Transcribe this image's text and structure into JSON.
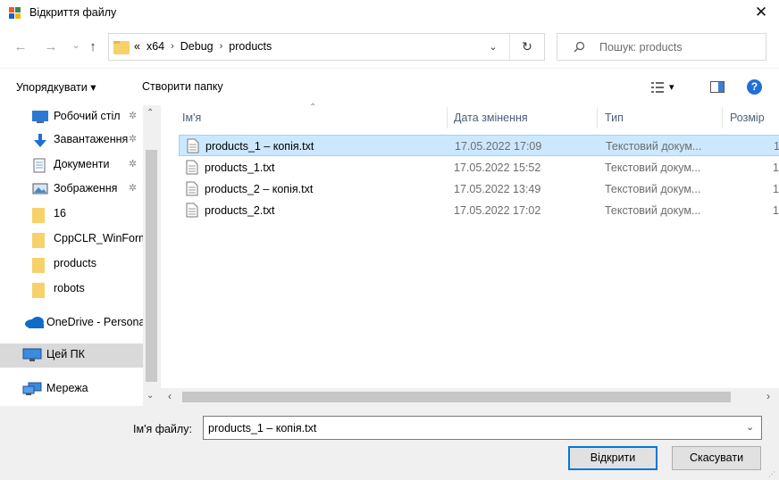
{
  "window": {
    "title": "Відкриття файлу",
    "close_glyph": "✕"
  },
  "navigation": {
    "back": "←",
    "forward": "→",
    "recent": "⌄",
    "up": "↑",
    "breadcrumb": {
      "overflow": "«",
      "items": [
        "x64",
        "Debug",
        "products"
      ],
      "separator": "›"
    },
    "refresh": "↻",
    "search_placeholder": "Пошук: products"
  },
  "toolbar": {
    "organize": "Упорядкувати ▾",
    "new_folder": "Створити папку",
    "view_caret": "▾"
  },
  "sidebar": {
    "items": [
      {
        "label": "Робочий стіл",
        "icon": "desktop-icon",
        "pinned": true
      },
      {
        "label": "Завантаження",
        "icon": "download-icon",
        "pinned": true
      },
      {
        "label": "Документи",
        "icon": "documents-icon",
        "pinned": true
      },
      {
        "label": "Зображення",
        "icon": "pictures-icon",
        "pinned": true
      },
      {
        "label": "16",
        "icon": "folder-icon",
        "pinned": false
      },
      {
        "label": "CppCLR_WinForms",
        "icon": "folder-icon",
        "pinned": false
      },
      {
        "label": "products",
        "icon": "folder-icon",
        "pinned": false
      },
      {
        "label": "robots",
        "icon": "folder-icon",
        "pinned": false
      },
      {
        "label": "OneDrive - Personal",
        "icon": "onedrive-icon",
        "pinned": false
      },
      {
        "label": "Цей ПК",
        "icon": "this-pc-icon",
        "pinned": false,
        "selected": true
      },
      {
        "label": "Мережа",
        "icon": "network-icon",
        "pinned": false
      }
    ],
    "pin_glyph": "✲"
  },
  "file_list": {
    "columns": {
      "name": "Ім'я",
      "date": "Дата змінення",
      "type": "Тип",
      "size": "Розмір"
    },
    "rows": [
      {
        "name": "products_1 – копія.txt",
        "date": "17.05.2022 17:09",
        "type": "Текстовий докум...",
        "size": "1",
        "selected": true
      },
      {
        "name": "products_1.txt",
        "date": "17.05.2022 15:52",
        "type": "Текстовий докум...",
        "size": "1"
      },
      {
        "name": "products_2 – копія.txt",
        "date": "17.05.2022 13:49",
        "type": "Текстовий докум...",
        "size": "1"
      },
      {
        "name": "products_2.txt",
        "date": "17.05.2022 17:02",
        "type": "Текстовий докум...",
        "size": "1"
      }
    ]
  },
  "footer": {
    "filename_label": "Ім'я файлу:",
    "filename_value": "products_1 – копія.txt",
    "open_button": "Відкрити",
    "cancel_button": "Скасувати"
  },
  "colors": {
    "selection": "#cce8ff",
    "selection_border": "#99d1ff",
    "accent": "#0078d7",
    "folder": "#f7d26a"
  }
}
